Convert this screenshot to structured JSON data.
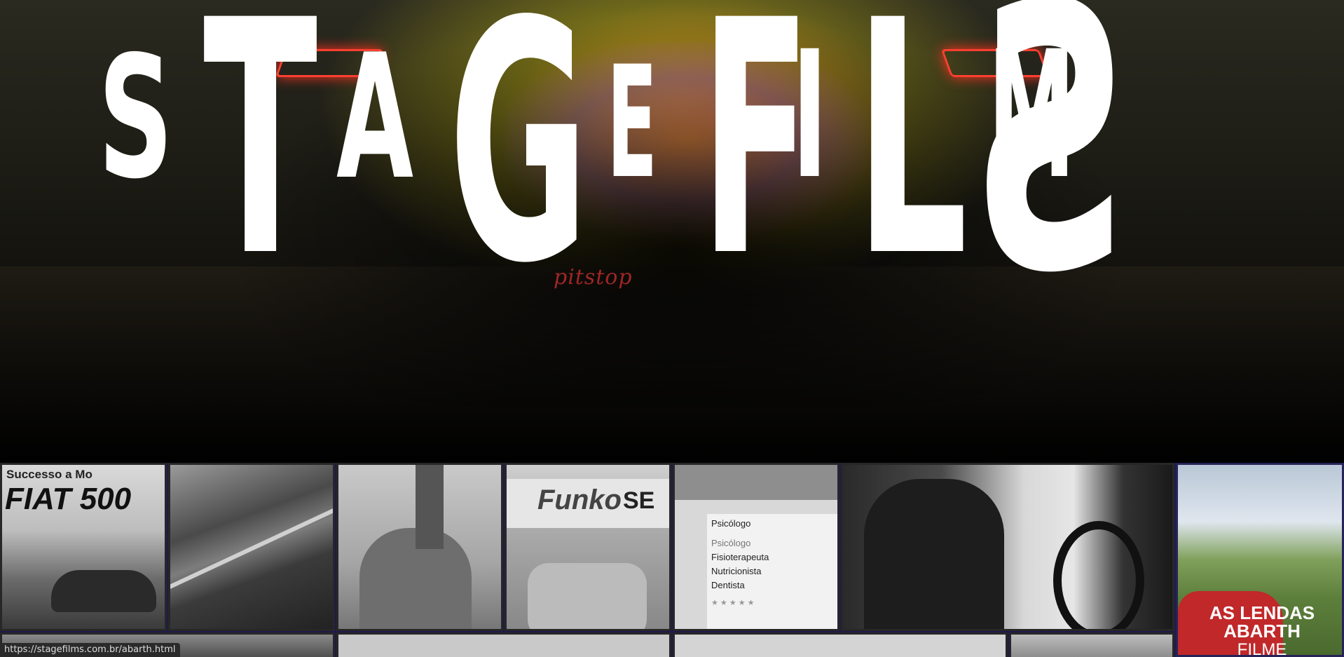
{
  "brand": {
    "logo_letters": [
      "S",
      "T",
      "A",
      "G",
      "E",
      "F",
      "I",
      "L",
      "M",
      "S"
    ]
  },
  "hero": {
    "rear_badge_text": "pitstop"
  },
  "grid": {
    "tiles": [
      {
        "name": "fiat-500",
        "caption_line1": "Successo a Mo",
        "caption_line2": "FIAT 500"
      },
      {
        "name": "highway",
        "caption_line1": ""
      },
      {
        "name": "surgeon",
        "caption_line1": ""
      },
      {
        "name": "funko",
        "caption_line1": "Funko",
        "caption_line2": "SE"
      },
      {
        "name": "app-screen",
        "title": "Psicólogo",
        "items": [
          "Psicólogo",
          "Fisioterapeuta",
          "Nutricionista",
          "Dentista"
        ],
        "rating": "★ ★ ★ ★ ★"
      },
      {
        "name": "driver",
        "caption_line1": ""
      },
      {
        "name": "abarth",
        "caption_line1": "AS LENDAS",
        "caption_line2": "ABARTH",
        "caption_line3": "FILME"
      }
    ]
  },
  "status_url": "https://stagefilms.com.br/abarth.html",
  "colors": {
    "grid_border": "#262358",
    "logo": "#ffffff"
  }
}
